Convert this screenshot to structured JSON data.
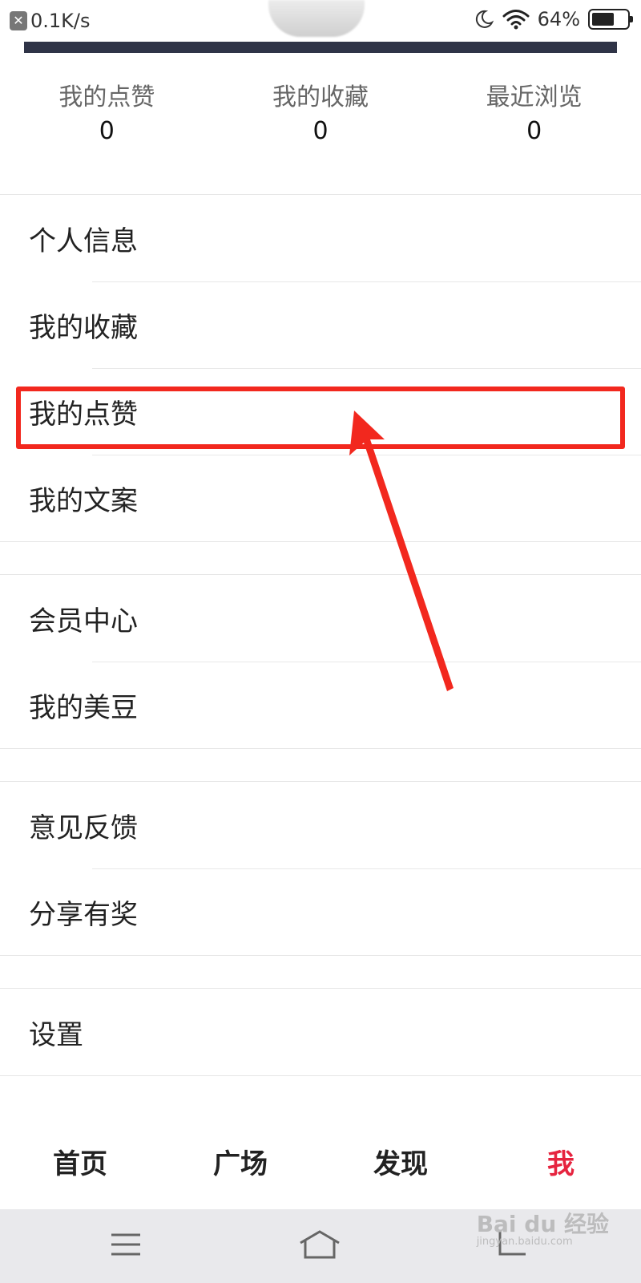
{
  "status_bar": {
    "speed": "0.1K/s",
    "battery": "64%",
    "battery_level": 0.64
  },
  "stats": [
    {
      "label": "我的点赞",
      "value": "0"
    },
    {
      "label": "我的收藏",
      "value": "0"
    },
    {
      "label": "最近浏览",
      "value": "0"
    }
  ],
  "menu": {
    "group1": [
      "个人信息",
      "我的收藏",
      "我的点赞",
      "我的文案"
    ],
    "group2": [
      "会员中心",
      "我的美豆"
    ],
    "group3": [
      "意见反馈",
      "分享有奖"
    ],
    "group4": [
      "设置"
    ]
  },
  "highlighted_item": "我的点赞",
  "tabs": [
    {
      "label": "首页",
      "active": false
    },
    {
      "label": "广场",
      "active": false
    },
    {
      "label": "发现",
      "active": false
    },
    {
      "label": "我",
      "active": true
    }
  ],
  "watermark": {
    "brand": "Bai du 经验",
    "url": "jingyan.baidu.com"
  },
  "colors": {
    "accent": "#e6243f",
    "highlight": "#f2281e",
    "header_bar": "#2f3447",
    "nav_bg": "#e9e9ec"
  },
  "icons": [
    "wifi-icon",
    "moon-icon",
    "battery-icon",
    "menu-icon",
    "home-icon",
    "back-icon"
  ]
}
